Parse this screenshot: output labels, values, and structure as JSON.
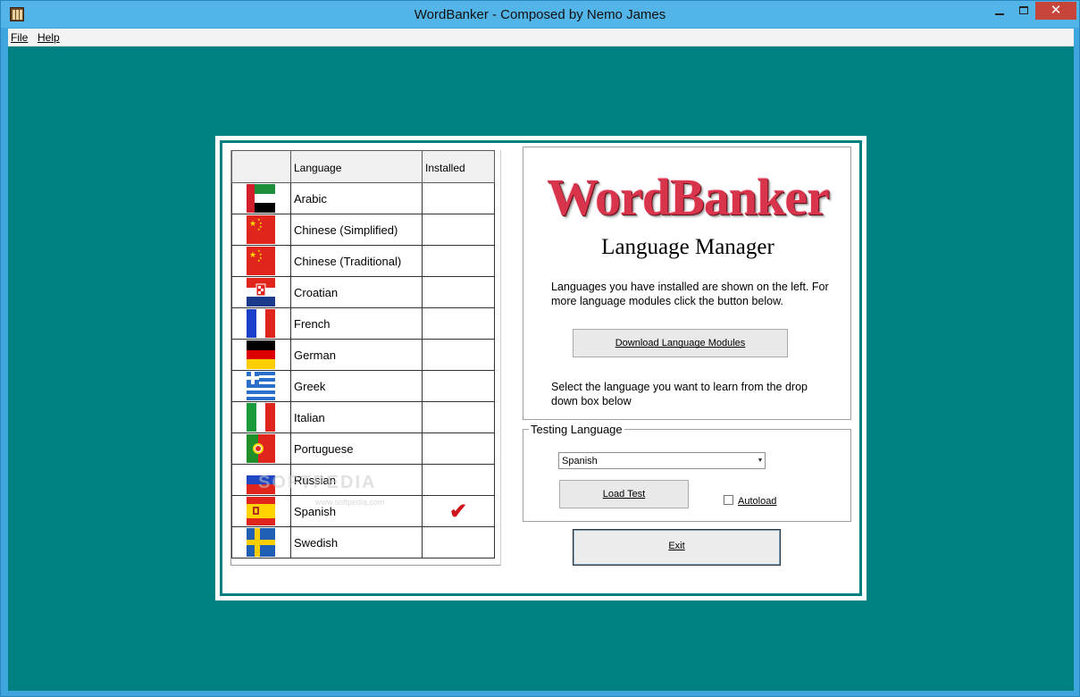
{
  "window": {
    "title": "WordBanker - Composed by Nemo James",
    "close_glyph": "✕",
    "icons": [
      "app-icon",
      "minimize-icon",
      "maximize-icon",
      "close-icon"
    ]
  },
  "menu": {
    "file": "File",
    "help": "Help"
  },
  "colors": {
    "client_bg": "#008080",
    "check": "#d0141e",
    "logo": "#d8344c"
  },
  "grid": {
    "headers": {
      "flag": "",
      "language": "Language",
      "installed": "Installed"
    },
    "rows": [
      {
        "language": "Arabic",
        "installed": "",
        "flag": "uae-flag-icon"
      },
      {
        "language": "Chinese (Simplified)",
        "installed": "",
        "flag": "china-flag-icon"
      },
      {
        "language": "Chinese (Traditional)",
        "installed": "",
        "flag": "china-flag-icon"
      },
      {
        "language": "Croatian",
        "installed": "",
        "flag": "croatia-flag-icon"
      },
      {
        "language": "French",
        "installed": "",
        "flag": "france-flag-icon"
      },
      {
        "language": "German",
        "installed": "",
        "flag": "germany-flag-icon"
      },
      {
        "language": "Greek",
        "installed": "",
        "flag": "greece-flag-icon"
      },
      {
        "language": "Italian",
        "installed": "",
        "flag": "italy-flag-icon"
      },
      {
        "language": "Portuguese",
        "installed": "",
        "flag": "portugal-flag-icon"
      },
      {
        "language": "Russian",
        "installed": "",
        "flag": "russia-flag-icon"
      },
      {
        "language": "Spanish",
        "installed": "✔",
        "flag": "spain-flag-icon"
      },
      {
        "language": "Swedish",
        "installed": "",
        "flag": "sweden-flag-icon"
      }
    ]
  },
  "info": {
    "logo": "WordBanker",
    "title": "Language Manager",
    "text1": "Languages you have installed are shown on the left. For more language modules click the button below.",
    "download_button": "Download Language Modules",
    "text2": "Select the language you want to learn from the drop down box below"
  },
  "testing": {
    "legend": "Testing Language",
    "selected": "Spanish",
    "load_button": "Load Test",
    "autoload_label": "Autoload",
    "autoload_checked": false
  },
  "exit_button": "Exit",
  "watermark": {
    "text": "SOFTPEDIA",
    "sub": "www.softpedia.com"
  }
}
